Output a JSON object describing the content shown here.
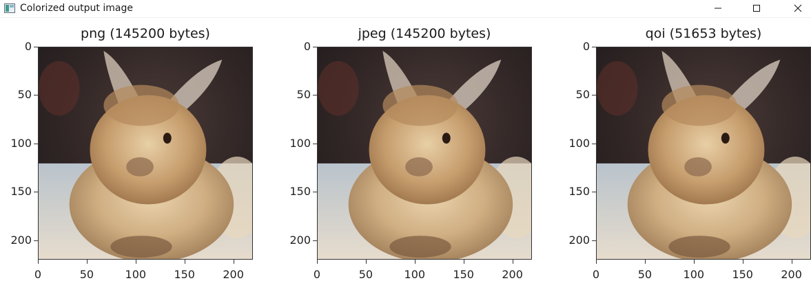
{
  "window": {
    "title": "Colorized output image",
    "icon": "image-window-icon",
    "controls": {
      "minimize": "minimize-icon",
      "maximize": "maximize-icon",
      "close": "close-icon"
    }
  },
  "figure": {
    "panels": [
      {
        "title": "png (145200 bytes)"
      },
      {
        "title": "jpeg (145200 bytes)"
      },
      {
        "title": "qoi (51653 bytes)"
      }
    ],
    "y_ticks": [
      "0",
      "50",
      "100",
      "150",
      "200"
    ],
    "x_ticks": [
      "0",
      "50",
      "100",
      "150",
      "200"
    ],
    "image_subject": "fluffy rabbit photo"
  },
  "chart_data": {
    "type": "image",
    "panels": [
      {
        "title": "png (145200 bytes)",
        "format": "png",
        "bytes": 145200
      },
      {
        "title": "jpeg (145200 bytes)",
        "format": "jpeg",
        "bytes": 145200
      },
      {
        "title": "qoi (51653 bytes)",
        "format": "qoi",
        "bytes": 51653
      }
    ],
    "xlim": [
      0,
      220
    ],
    "ylim": [
      220,
      0
    ],
    "x_ticks": [
      0,
      50,
      100,
      150,
      200
    ],
    "y_ticks": [
      0,
      50,
      100,
      150,
      200
    ],
    "grid": false
  },
  "colors": {
    "background": "#ffffff",
    "axis": "#333333",
    "fur_light": "#d9b98f",
    "fur_dark": "#8a6a4a",
    "backdrop_dark": "#2b2320",
    "floor": "#d8d4ce"
  }
}
